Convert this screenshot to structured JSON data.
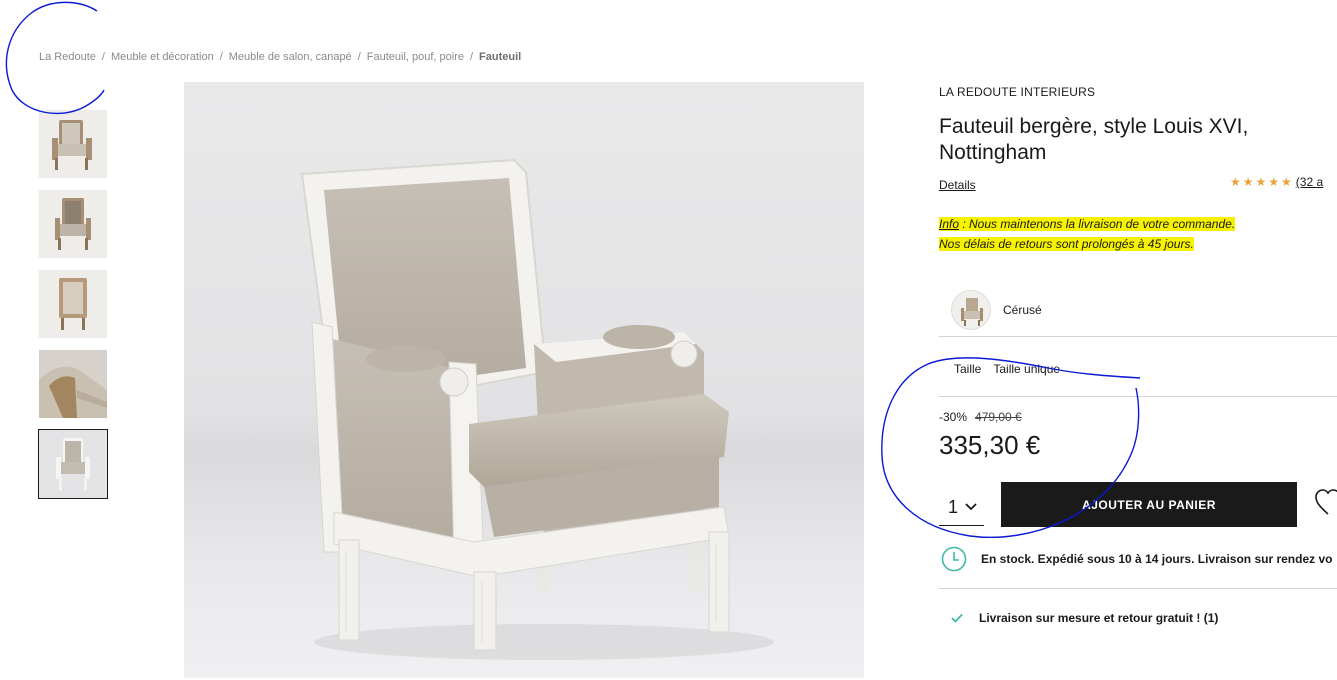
{
  "breadcrumb": {
    "items": [
      "La Redoute",
      "Meuble et décoration",
      "Meuble de salon, canapé",
      "Fauteuil, pouf, poire"
    ],
    "separator": "/",
    "current": "Fauteuil"
  },
  "gallery": {
    "thumb_count": 5,
    "active_index": 4
  },
  "product": {
    "brand": "LA REDOUTE INTERIEURS",
    "title": "Fauteuil bergère, style Louis XVI, Nottingham",
    "details_label": "Details",
    "rating": {
      "stars": "★★★★★",
      "count_label": "(32 a"
    },
    "info": {
      "link": "Info",
      "line1_rest": " : Nous maintenons la livraison de votre commande.",
      "line2": "Nos délais de retours sont prolongés à 45 jours."
    },
    "color_label": "Cérusé",
    "size": {
      "label": "Taille",
      "value": "Taille unique"
    },
    "discount": "-30%",
    "old_price": "479,00 €",
    "price": "335,30 €",
    "quantity": "1",
    "add_to_cart": "AJOUTER AU PANIER",
    "stock_text": "En stock. Expédié sous 10 à 14 jours. Livraison sur rendez vo",
    "delivery_text": "Livraison sur mesure et retour gratuit ! (1)"
  },
  "colors": {
    "accent_black": "#1a1a1a",
    "star": "#e8a43a",
    "highlight": "#f6f200",
    "clock_teal": "#3fb8a8",
    "annotation": "#0a1ad6"
  }
}
